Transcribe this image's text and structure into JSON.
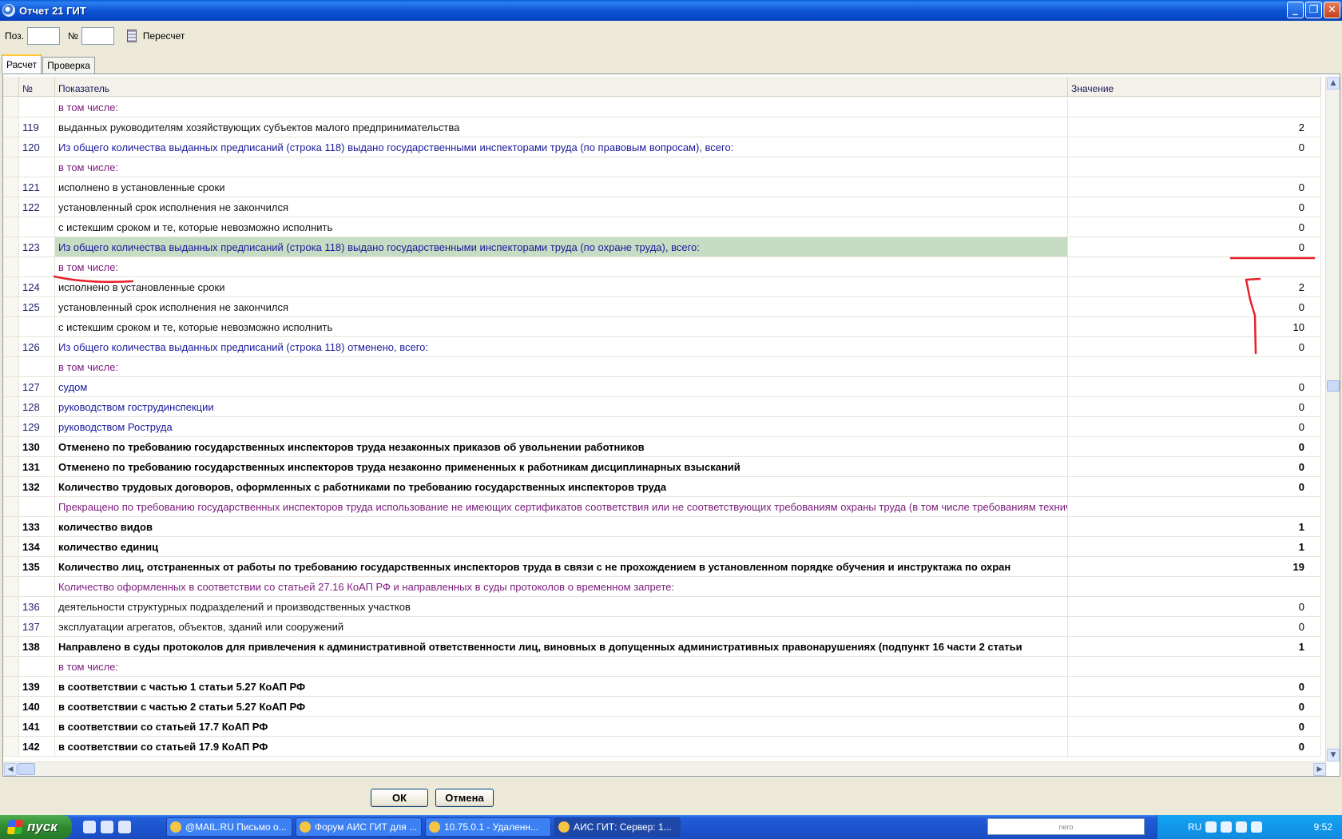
{
  "window": {
    "title": "Отчет 21 ГИТ",
    "minimize": "_",
    "maximize": "❐",
    "close": "✕"
  },
  "toolbar": {
    "pos_label": "Поз.",
    "pos_value": "",
    "num_label": "№",
    "num_value": "",
    "recalc_label": "Пересчет"
  },
  "tabs": [
    {
      "label": "Расчет",
      "active": true
    },
    {
      "label": "Проверка",
      "active": false
    }
  ],
  "table": {
    "columns": [
      "№",
      "Показатель",
      "Значение"
    ],
    "rows": [
      {
        "num": "",
        "label": "в том числе:",
        "value": "",
        "style": "purple"
      },
      {
        "num": "119",
        "label": "выданных руководителям хозяйствующих субъектов малого предпринимательства",
        "value": "2",
        "style": "black"
      },
      {
        "num": "120",
        "label": "Из общего количества выданных предписаний (строка 118) выдано государственными инспекторами труда (по правовым вопросам), всего:",
        "value": "0",
        "style": "blue"
      },
      {
        "num": "",
        "label": "в том числе:",
        "value": "",
        "style": "purple"
      },
      {
        "num": "121",
        "label": "исполнено в установленные сроки",
        "value": "0",
        "style": "black"
      },
      {
        "num": "122",
        "label": "установленный срок исполнения не закончился",
        "value": "0",
        "style": "black"
      },
      {
        "num": "",
        "label": "с истекшим сроком и те, которые невозможно исполнить",
        "value": "0",
        "style": "black"
      },
      {
        "num": "123",
        "label": "Из общего количества выданных предписаний (строка 118) выдано государственными инспекторами труда (по охране труда), всего:",
        "value": "0",
        "style": "blue",
        "highlight": true
      },
      {
        "num": "",
        "label": "в том числе:",
        "value": "",
        "style": "purple"
      },
      {
        "num": "124",
        "label": "исполнено в установленные сроки",
        "value": "2",
        "style": "black"
      },
      {
        "num": "125",
        "label": "установленный срок исполнения не закончился",
        "value": "0",
        "style": "black"
      },
      {
        "num": "",
        "label": "с истекшим сроком и те, которые невозможно исполнить",
        "value": "10",
        "style": "black"
      },
      {
        "num": "126",
        "label": "Из общего количества выданных предписаний (строка 118) отменено, всего:",
        "value": "0",
        "style": "blue"
      },
      {
        "num": "",
        "label": "в том числе:",
        "value": "",
        "style": "purple"
      },
      {
        "num": "127",
        "label": "судом",
        "value": "0",
        "style": "blue"
      },
      {
        "num": "128",
        "label": "руководством гострудинспекции",
        "value": "0",
        "style": "blue"
      },
      {
        "num": "129",
        "label": "руководством Роструда",
        "value": "0",
        "style": "blue"
      },
      {
        "num": "130",
        "label": "Отменено по требованию государственных инспекторов труда незаконных приказов об увольнении работников",
        "value": "0",
        "style": "bold"
      },
      {
        "num": "131",
        "label": "Отменено по требованию государственных инспекторов труда незаконно примененных к работникам дисциплинарных взысканий",
        "value": "0",
        "style": "bold"
      },
      {
        "num": "132",
        "label": "Количество трудовых договоров, оформленных с работниками по требованию государственных инспекторов труда",
        "value": "0",
        "style": "bold"
      },
      {
        "num": "",
        "label": "Прекращено по требованию государственных инспекторов труда  использование не имеющих сертификатов соответствия или не соответствующих требованиям охраны труда (в том числе требованиям технич",
        "value": "",
        "style": "purple"
      },
      {
        "num": "133",
        "label": "количество видов",
        "value": "1",
        "style": "bold"
      },
      {
        "num": "134",
        "label": "количество единиц",
        "value": "1",
        "style": "bold"
      },
      {
        "num": "135",
        "label": "Количество лиц, отстраненных от работы по требованию государственных инспекторов труда в связи с не прохождением в установленном порядке обучения и инструктажа по охран",
        "value": "19",
        "style": "bold"
      },
      {
        "num": "",
        "label": "Количество оформленных в соответствии со статьей 27.16 КоАП РФ и направленных в суды протоколов о временном запрете:",
        "value": "",
        "style": "purple"
      },
      {
        "num": "136",
        "label": "деятельности структурных подразделений и производственных участков",
        "value": "0",
        "style": "black"
      },
      {
        "num": "137",
        "label": "эксплуатации агрегатов, объектов, зданий или сооружений",
        "value": "0",
        "style": "black"
      },
      {
        "num": "138",
        "label": "Направлено в суды протоколов для привлечения к административной ответственности лиц, виновных в допущенных административных правонарушениях (подпункт 16 части 2 статьи",
        "value": "1",
        "style": "bold"
      },
      {
        "num": "",
        "label": "в том числе:",
        "value": "",
        "style": "purple"
      },
      {
        "num": "139",
        "label": "в соответствии с частью 1 статьи 5.27 КоАП РФ",
        "value": "0",
        "style": "bold"
      },
      {
        "num": "140",
        "label": "в соответствии с частью 2 статьи 5.27 КоАП РФ",
        "value": "0",
        "style": "bold"
      },
      {
        "num": "141",
        "label": "в соответствии со статьей 17.7 КоАП РФ",
        "value": "0",
        "style": "bold"
      },
      {
        "num": "142",
        "label": "в соответствии со статьей 17.9 КоАП РФ",
        "value": "0",
        "style": "bold"
      }
    ]
  },
  "buttons": {
    "ok": "ОК",
    "cancel": "Отмена"
  },
  "taskbar": {
    "start": "пуск",
    "tasks": [
      {
        "label": "@MAIL.RU Письмо о...",
        "active": false
      },
      {
        "label": "Форум АИС ГИТ для ...",
        "active": false
      },
      {
        "label": "10.75.0.1 - Удаленн...",
        "active": false
      },
      {
        "label": "АИС ГИТ: Сервер: 1...",
        "active": true
      }
    ],
    "search_brand": "nero",
    "language": "RU",
    "clock": "9:52"
  },
  "colors": {
    "highlight_row": "#c6ddc4",
    "annotation": "#e8202a",
    "taskbar": "#245edb"
  }
}
